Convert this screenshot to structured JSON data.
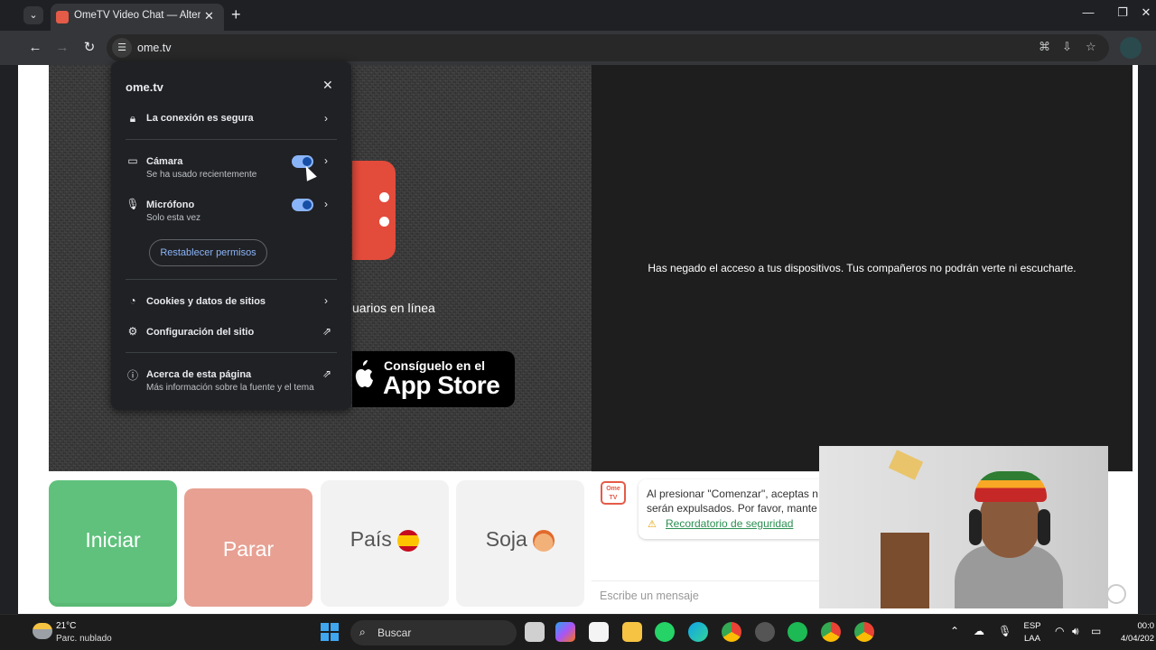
{
  "browser": {
    "tab_title": "OmeTV Video Chat — Alternati",
    "url": "ome.tv"
  },
  "popup": {
    "host": "ome.tv",
    "connection": "La conexión es segura",
    "camera_label": "Cámara",
    "camera_sub": "Se ha usado recientemente",
    "camera_on": true,
    "mic_label": "Micrófono",
    "mic_sub": "Solo esta vez",
    "mic_on": true,
    "reset_label": "Restablecer permisos",
    "cookies": "Cookies y datos de sitios",
    "site_settings": "Configuración del sitio",
    "about_label": "Acerca de esta página",
    "about_sub": "Más información sobre la fuente y el tema"
  },
  "page": {
    "users_online": "uarios en línea",
    "appstore_top": "Consíguelo en el",
    "appstore_big": "App Store",
    "denied_message": "Has negado el acceso a tus dispositivos. Tus compañeros no podrán verte ni escucharte.",
    "buttons": {
      "start": "Iniciar",
      "stop": "Parar",
      "country": "País",
      "gender": "Soja"
    },
    "chat": {
      "logo": "Ome TV",
      "line1": "Al presionar \"Comenzar\", aceptas n",
      "line2": "serán expulsados. Por favor, mante",
      "link": "Recordatorio de seguridad",
      "placeholder": "Escribe un mensaje"
    }
  },
  "taskbar": {
    "temp": "21°C",
    "weather": "Parc. nublado",
    "search": "Buscar",
    "lang1": "ESP",
    "lang2": "LAA",
    "time": "00:0",
    "date": "4/04/202"
  },
  "colors": {
    "start_green": "#5fc17c",
    "stop_salmon": "#e7a092",
    "toggle_blue": "#8ab4f8",
    "link_green": "#2b8f52",
    "logo_red": "#e34b3b"
  }
}
